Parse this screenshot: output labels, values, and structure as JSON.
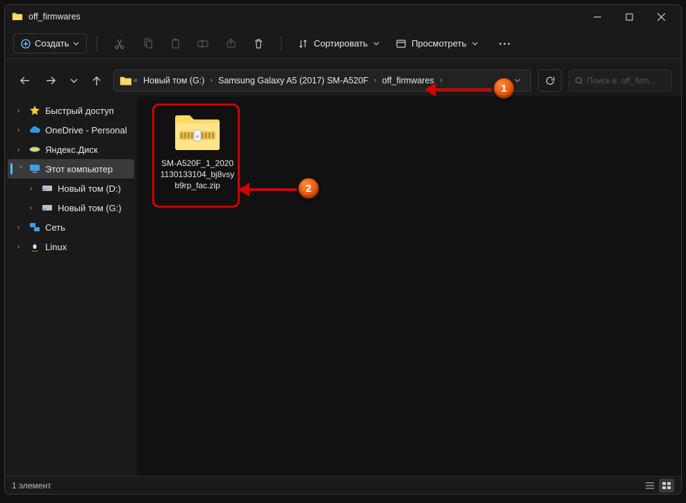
{
  "titlebar": {
    "title": "off_firmwares"
  },
  "toolbar": {
    "create": "Создать",
    "sort": "Сортировать",
    "view": "Просмотреть"
  },
  "breadcrumb": {
    "items": [
      "Новый том (G:)",
      "Samsung Galaxy A5 (2017) SM-A520F",
      "off_firmwares"
    ]
  },
  "search": {
    "placeholder": "Поиск в: off_firm..."
  },
  "sidebar": {
    "items": [
      {
        "label": "Быстрый доступ",
        "type": "star"
      },
      {
        "label": "OneDrive - Personal",
        "type": "cloud"
      },
      {
        "label": "Яндекс.Диск",
        "type": "yadisk"
      },
      {
        "label": "Этот компьютер",
        "type": "pc",
        "selected": true
      },
      {
        "label": "Новый том (D:)",
        "type": "drive",
        "child": true
      },
      {
        "label": "Новый том (G:)",
        "type": "drive",
        "child": true
      },
      {
        "label": "Сеть",
        "type": "net"
      },
      {
        "label": "Linux",
        "type": "linux"
      }
    ]
  },
  "file": {
    "name": "SM-A520F_1_20201130133104_bj8vsyb9rp_fac.zip"
  },
  "status": {
    "count": "1 элемент"
  },
  "annotations": {
    "b1": "1",
    "b2": "2"
  }
}
